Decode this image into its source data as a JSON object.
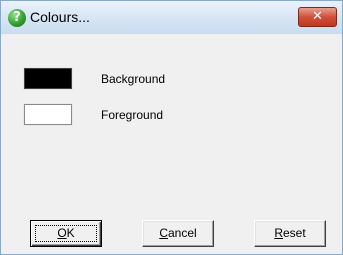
{
  "window": {
    "title": "Colours...",
    "close_glyph": "✕",
    "help_glyph": "?"
  },
  "colours": [
    {
      "label": "Background",
      "swatch": "#000000"
    },
    {
      "label": "Foreground",
      "swatch": "#ffffff"
    }
  ],
  "buttons": {
    "ok": {
      "accel": "O",
      "rest": "K"
    },
    "cancel": {
      "accel": "C",
      "rest": "ancel"
    },
    "reset": {
      "accel": "R",
      "rest": "eset"
    }
  }
}
